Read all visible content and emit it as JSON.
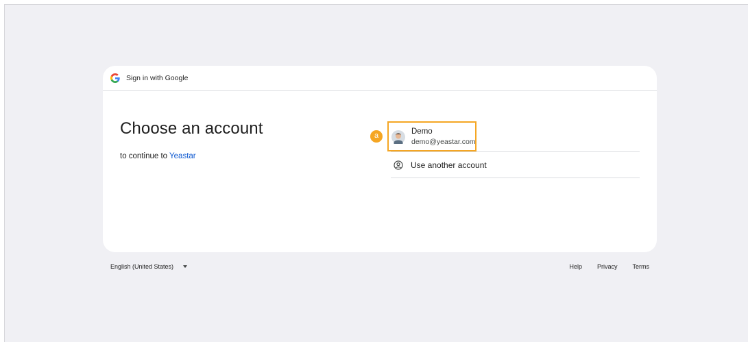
{
  "header": {
    "title": "Sign in with Google",
    "logo_icon": "google-g-icon"
  },
  "main": {
    "title": "Choose an account",
    "subtitle_prefix": "to continue to ",
    "subtitle_link": "Yeastar"
  },
  "accounts": [
    {
      "name": "Demo",
      "email": "demo@yeastar.com",
      "avatar_icon": "avatar-icon"
    }
  ],
  "other_account": {
    "label": "Use another account",
    "icon": "person-circle-icon"
  },
  "annotation": {
    "marker": "a",
    "color": "#f5a623"
  },
  "footer": {
    "language": "English (United States)",
    "links": [
      "Help",
      "Privacy",
      "Terms"
    ]
  },
  "colors": {
    "link": "#0b57d0",
    "background": "#f0f0f4",
    "card": "#ffffff",
    "highlight": "#f5a623"
  }
}
